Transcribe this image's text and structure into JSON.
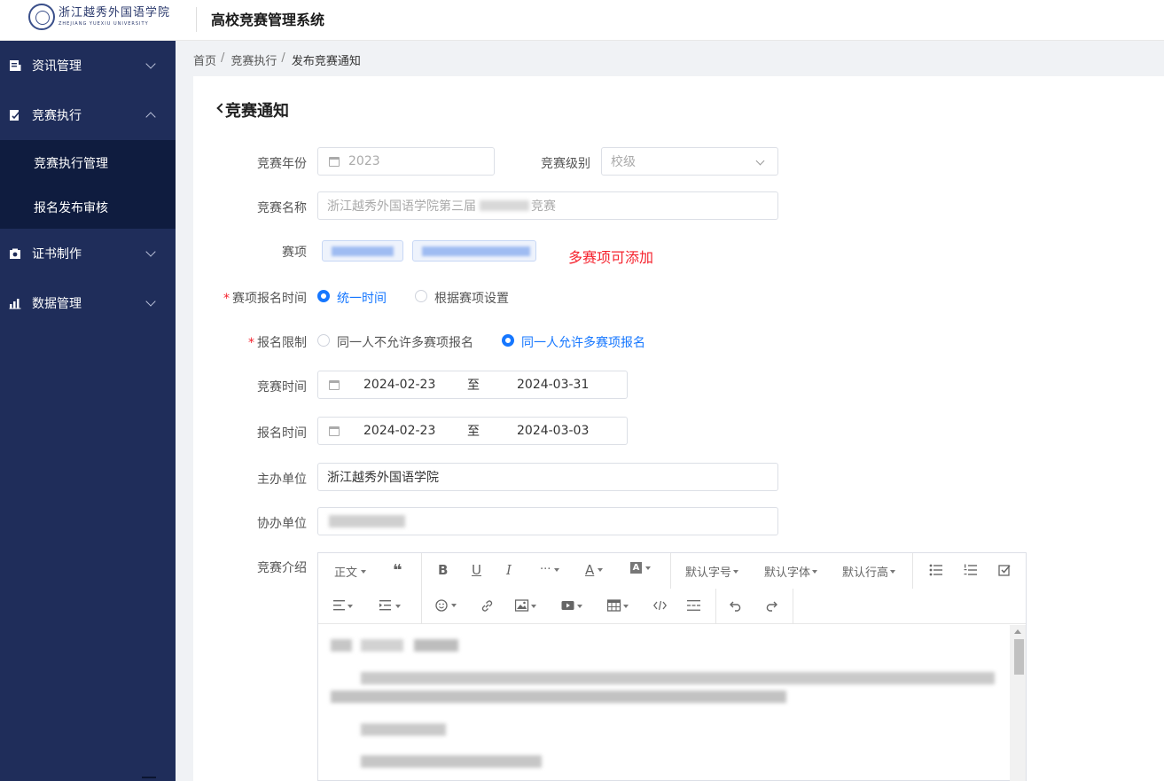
{
  "header": {
    "logo_cn": "浙江越秀外国语学院",
    "logo_en": "ZHEJIANG YUEXIU UNIVERSITY",
    "system_title": "高校竞赛管理系统"
  },
  "sidebar": {
    "items": [
      {
        "label": "资讯管理",
        "icon": "news-icon",
        "expanded": false
      },
      {
        "label": "竞赛执行",
        "icon": "edit-doc-icon",
        "expanded": true
      },
      {
        "label": "证书制作",
        "icon": "camera-icon",
        "expanded": false
      },
      {
        "label": "数据管理",
        "icon": "bar-chart-icon",
        "expanded": false
      }
    ],
    "sub_items": [
      "竞赛执行管理",
      "报名发布审核"
    ]
  },
  "breadcrumb": [
    "首页",
    "竞赛执行",
    "发布竞赛通知"
  ],
  "page": {
    "title": "竞赛通知",
    "form": {
      "year_label": "竞赛年份",
      "year_value": "2023",
      "level_label": "竞赛级别",
      "level_value": "校级",
      "name_label": "竞赛名称",
      "name_value": "浙江越秀外国语学院第三届",
      "name_suffix": "竞赛",
      "items_label": "赛项",
      "items_hint": "多赛项可添加",
      "reg_time_label": "赛项报名时间",
      "reg_time_options": [
        "统一时间",
        "根据赛项设置"
      ],
      "reg_time_selected": 0,
      "reg_limit_label": "报名限制",
      "reg_limit_options": [
        "同一人不允许多赛项报名",
        "同一人允许多赛项报名"
      ],
      "reg_limit_selected": 1,
      "comp_time_label": "竞赛时间",
      "comp_time_start": "2024-02-23",
      "comp_time_sep": "至",
      "comp_time_end": "2024-03-31",
      "signup_time_label": "报名时间",
      "signup_time_start": "2024-02-23",
      "signup_time_sep": "至",
      "signup_time_end": "2024-03-03",
      "host_label": "主办单位",
      "host_value": "浙江越秀外国语学院",
      "cohost_label": "协办单位",
      "intro_label": "竞赛介绍"
    },
    "editor_toolbar": {
      "paragraph": "正文",
      "font_size": "默认字号",
      "font_family": "默认字体",
      "line_height": "默认行高",
      "more": "···"
    }
  },
  "colors": {
    "sidebar_bg": "#1f2d5a",
    "submenu_bg": "#0f1c3f",
    "accent": "#1677ff",
    "required": "#f5222d"
  }
}
